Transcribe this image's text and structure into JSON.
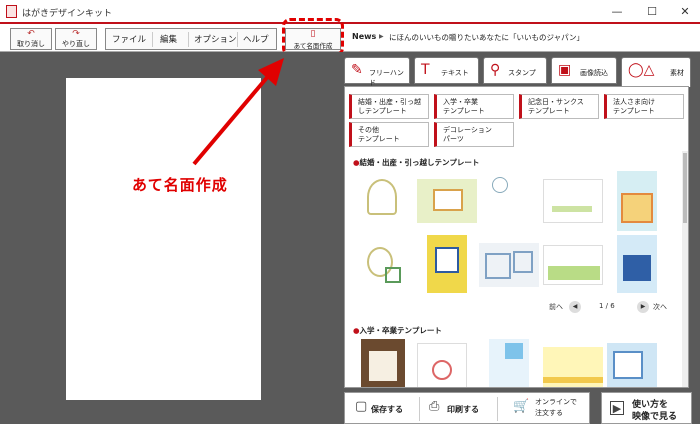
{
  "window": {
    "title": "はがきデザインキット",
    "minimize": "—",
    "maximize": "☐",
    "close": "✕"
  },
  "toolbar": {
    "undo_label": "取り消し",
    "redo_label": "やり直し",
    "menus": [
      "ファイル",
      "編集",
      "オプション",
      "ヘルプ"
    ],
    "atena_label": "あて名面作成"
  },
  "news": {
    "label": "News",
    "text": "にほんのいいもの贈りたいあなたに「いいものジャパン」"
  },
  "annotation": {
    "text": "あて名面作成"
  },
  "tabs": [
    {
      "label": "フリーハンド",
      "icon": "pencil-icon"
    },
    {
      "label": "テキスト",
      "icon": "text-icon"
    },
    {
      "label": "スタンプ",
      "icon": "stamp-icon"
    },
    {
      "label": "画像読込",
      "icon": "image-icon"
    },
    {
      "label": "素材",
      "icon": "shapes-icon",
      "active": true
    }
  ],
  "categories": [
    {
      "line1": "結婚・出産・引っ越",
      "line2": "しテンプレート"
    },
    {
      "line1": "入学・卒業",
      "line2": "テンプレート"
    },
    {
      "line1": "記念日・サンクス",
      "line2": "テンプレート"
    },
    {
      "line1": "法人さま向け",
      "line2": "テンプレート"
    },
    {
      "line1": "その他",
      "line2": "テンプレート"
    },
    {
      "line1": "デコレーション",
      "line2": "パーツ"
    }
  ],
  "sections": {
    "first": "結婚・出産・引っ越しテンプレート",
    "second": "入学・卒業テンプレート"
  },
  "pager": {
    "prev": "前へ",
    "page": "1 / 6",
    "next": "次へ"
  },
  "bottom": {
    "save": "保存する",
    "print": "印刷する",
    "online1": "オンラインで",
    "online2": "注文する",
    "howto1": "使い方を",
    "howto2": "映像で見る"
  },
  "colors": {
    "accent": "#c0101a",
    "annotation": "#e00000",
    "panel": "#5a5a5a"
  }
}
